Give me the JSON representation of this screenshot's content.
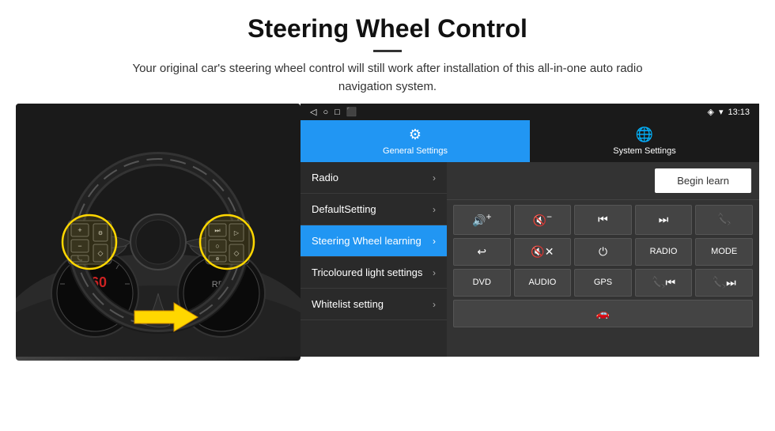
{
  "header": {
    "title": "Steering Wheel Control",
    "divider": true,
    "description": "Your original car's steering wheel control will still work after installation of this all-in-one auto radio navigation system."
  },
  "status_bar": {
    "time": "13:13",
    "icons": [
      "location",
      "wifi",
      "signal"
    ]
  },
  "tabs": [
    {
      "id": "general",
      "label": "General Settings",
      "icon": "⚙",
      "active": true
    },
    {
      "id": "system",
      "label": "System Settings",
      "icon": "🌐",
      "active": false
    }
  ],
  "menu_items": [
    {
      "id": "radio",
      "label": "Radio",
      "active": false
    },
    {
      "id": "default",
      "label": "DefaultSetting",
      "active": false
    },
    {
      "id": "steering",
      "label": "Steering Wheel learning",
      "active": true
    },
    {
      "id": "tricolour",
      "label": "Tricoloured light settings",
      "active": false
    },
    {
      "id": "whitelist",
      "label": "Whitelist setting",
      "active": false
    }
  ],
  "right_panel": {
    "begin_learn_label": "Begin learn",
    "control_rows": [
      [
        {
          "id": "vol_up",
          "label": "🔊+",
          "symbol": "🔊+"
        },
        {
          "id": "vol_down",
          "label": "🔇-",
          "symbol": "🔇−"
        },
        {
          "id": "prev_track",
          "label": "⏮",
          "symbol": "⏮"
        },
        {
          "id": "next_track",
          "label": "⏭",
          "symbol": "⏭"
        },
        {
          "id": "call",
          "label": "📞",
          "symbol": "📞"
        }
      ],
      [
        {
          "id": "hang_up",
          "label": "↩",
          "symbol": "↩"
        },
        {
          "id": "mute",
          "label": "🔇x",
          "symbol": "🔇✕"
        },
        {
          "id": "power",
          "label": "⏻",
          "symbol": "⏻"
        },
        {
          "id": "radio_btn",
          "label": "RADIO",
          "symbol": "RADIO"
        },
        {
          "id": "mode_btn",
          "label": "MODE",
          "symbol": "MODE"
        }
      ],
      [
        {
          "id": "dvd_btn",
          "label": "DVD",
          "symbol": "DVD"
        },
        {
          "id": "audio_btn",
          "label": "AUDIO",
          "symbol": "AUDIO"
        },
        {
          "id": "gps_btn",
          "label": "GPS",
          "symbol": "GPS"
        },
        {
          "id": "tel_prev",
          "label": "📞⏮",
          "symbol": "📞⏮"
        },
        {
          "id": "tel_next",
          "label": "📞⏭",
          "symbol": "📞⏭"
        }
      ],
      [
        {
          "id": "extra",
          "label": "🚗",
          "symbol": "🚗"
        }
      ]
    ]
  }
}
